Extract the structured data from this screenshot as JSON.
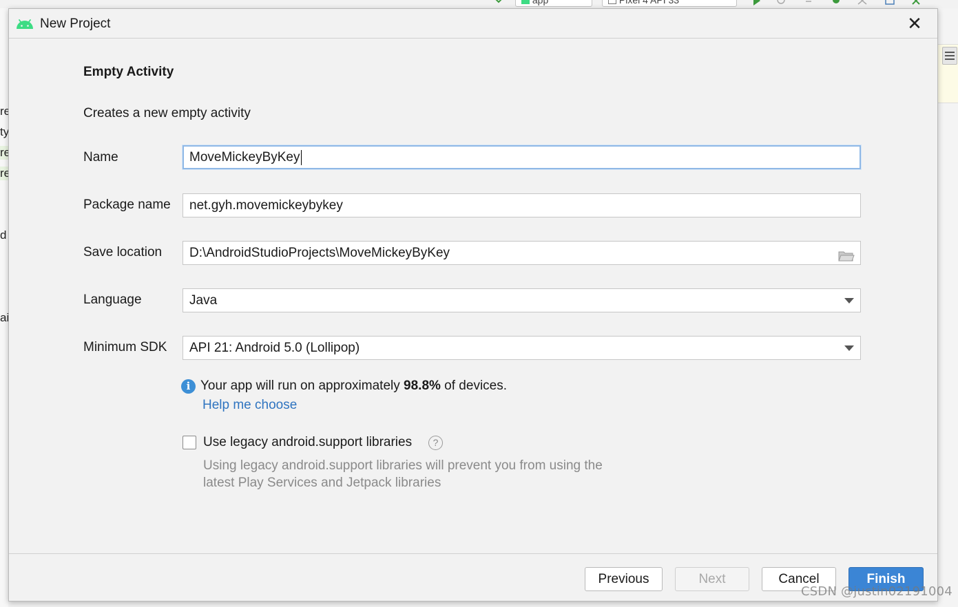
{
  "ide": {
    "run_config": "app",
    "device": "Pixel 4 API 33",
    "left_fragments": [
      "re",
      "ty",
      "re",
      "re",
      "d",
      "ai"
    ]
  },
  "dialog": {
    "title": "New Project",
    "close_glyph": "✕",
    "heading": "Empty Activity",
    "description": "Creates a new empty activity",
    "fields": {
      "name": {
        "label": "Name",
        "value": "MoveMickeyByKey"
      },
      "package": {
        "label": "Package name",
        "value": "net.gyh.movemickeybykey"
      },
      "save_location": {
        "label": "Save location",
        "value": "D:\\AndroidStudioProjects\\MoveMickeyByKey"
      },
      "language": {
        "label": "Language",
        "value": "Java"
      },
      "min_sdk": {
        "label": "Minimum SDK",
        "value": "API 21: Android 5.0 (Lollipop)"
      }
    },
    "info": {
      "prefix": "Your app will run on approximately ",
      "percent": "98.8%",
      "suffix": " of devices.",
      "help_link": "Help me choose"
    },
    "legacy": {
      "checked": false,
      "label": "Use legacy android.support libraries",
      "description": "Using legacy android.support libraries will prevent you from using the latest Play Services and Jetpack libraries"
    },
    "buttons": {
      "previous": "Previous",
      "next": "Next",
      "cancel": "Cancel",
      "finish": "Finish"
    }
  },
  "watermark": "CSDN @justin02191004",
  "colors": {
    "accent": "#3b85d5",
    "link": "#2f74c0",
    "android_green": "#3ddc84",
    "info_blue": "#3d8fd6"
  }
}
